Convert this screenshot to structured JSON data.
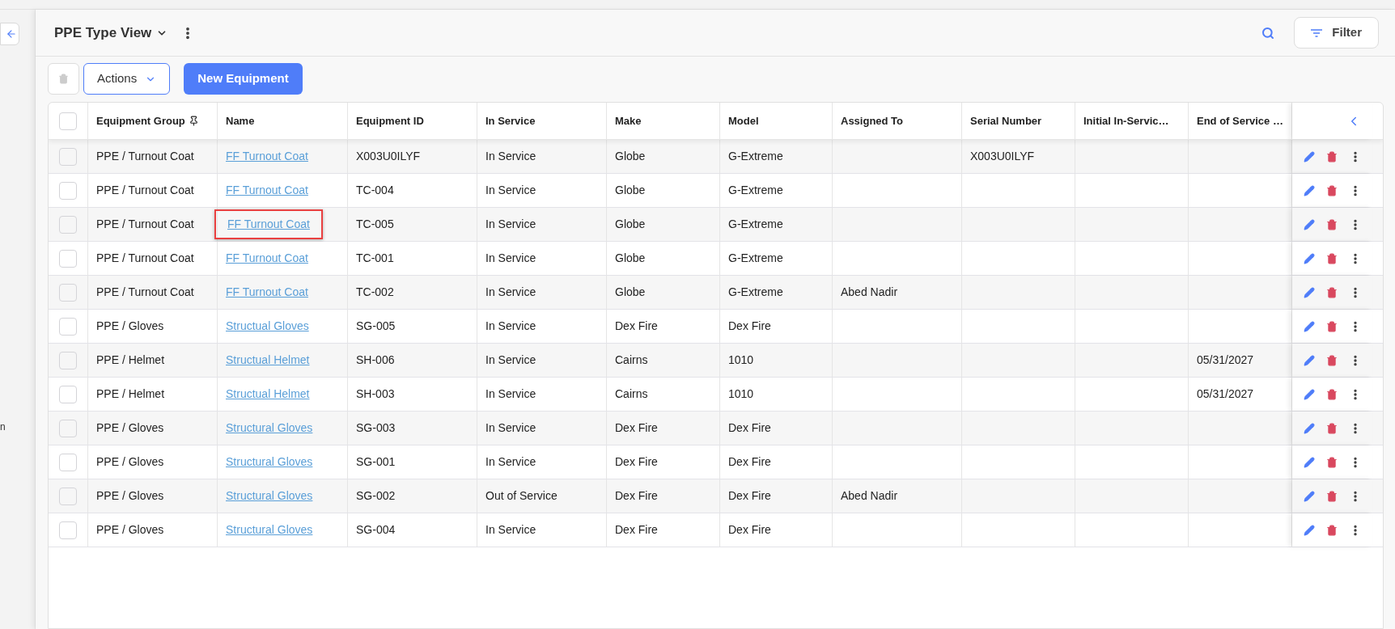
{
  "sidebar": {
    "partial_text": "n"
  },
  "header": {
    "title": "PPE Type View",
    "filter_label": "Filter"
  },
  "toolbar": {
    "actions_label": "Actions",
    "new_label": "New Equipment"
  },
  "table": {
    "header_checked": false,
    "columns": [
      {
        "label": "Equipment Group",
        "pinned": true
      },
      {
        "label": "Name",
        "pinned": false
      },
      {
        "label": "Equipment ID",
        "pinned": false
      },
      {
        "label": "In Service",
        "pinned": false
      },
      {
        "label": "Make",
        "pinned": false
      },
      {
        "label": "Model",
        "pinned": false
      },
      {
        "label": "Assigned To",
        "pinned": false
      },
      {
        "label": "Serial Number",
        "pinned": false
      },
      {
        "label": "Initial In-Servic…",
        "pinned": false
      },
      {
        "label": "End of Service …",
        "pinned": false
      }
    ],
    "rows": [
      {
        "checked": false,
        "highlighted": false,
        "cells": [
          "PPE / Turnout Coat",
          "FF Turnout Coat",
          "X003U0ILYF",
          "In Service",
          "Globe",
          "G-Extreme",
          "",
          "X003U0ILYF",
          "",
          ""
        ]
      },
      {
        "checked": false,
        "highlighted": false,
        "cells": [
          "PPE / Turnout Coat",
          "FF Turnout Coat",
          "TC-004",
          "In Service",
          "Globe",
          "G-Extreme",
          "",
          "",
          "",
          ""
        ]
      },
      {
        "checked": false,
        "highlighted": true,
        "cells": [
          "PPE / Turnout Coat",
          "FF Turnout Coat",
          "TC-005",
          "In Service",
          "Globe",
          "G-Extreme",
          "",
          "",
          "",
          ""
        ]
      },
      {
        "checked": false,
        "highlighted": false,
        "cells": [
          "PPE / Turnout Coat",
          "FF Turnout Coat",
          "TC-001",
          "In Service",
          "Globe",
          "G-Extreme",
          "",
          "",
          "",
          ""
        ]
      },
      {
        "checked": false,
        "highlighted": false,
        "cells": [
          "PPE / Turnout Coat",
          "FF Turnout Coat",
          "TC-002",
          "In Service",
          "Globe",
          "G-Extreme",
          "Abed Nadir",
          "",
          "",
          ""
        ]
      },
      {
        "checked": false,
        "highlighted": false,
        "cells": [
          "PPE / Gloves",
          "Structual Gloves",
          "SG-005",
          "In Service",
          "Dex Fire",
          "Dex Fire",
          "",
          "",
          "",
          ""
        ]
      },
      {
        "checked": false,
        "highlighted": false,
        "cells": [
          "PPE / Helmet",
          "Structual Helmet",
          "SH-006",
          "In Service",
          "Cairns",
          "1010",
          "",
          "",
          "",
          "05/31/2027"
        ]
      },
      {
        "checked": false,
        "highlighted": false,
        "cells": [
          "PPE / Helmet",
          "Structual Helmet",
          "SH-003",
          "In Service",
          "Cairns",
          "1010",
          "",
          "",
          "",
          "05/31/2027"
        ]
      },
      {
        "checked": false,
        "highlighted": false,
        "cells": [
          "PPE / Gloves",
          "Structural Gloves",
          "SG-003",
          "In Service",
          "Dex Fire",
          "Dex Fire",
          "",
          "",
          "",
          ""
        ]
      },
      {
        "checked": false,
        "highlighted": false,
        "cells": [
          "PPE / Gloves",
          "Structural Gloves",
          "SG-001",
          "In Service",
          "Dex Fire",
          "Dex Fire",
          "",
          "",
          "",
          ""
        ]
      },
      {
        "checked": false,
        "highlighted": false,
        "cells": [
          "PPE / Gloves",
          "Structural Gloves",
          "SG-002",
          "Out of Service",
          "Dex Fire",
          "Dex Fire",
          "Abed Nadir",
          "",
          "",
          ""
        ]
      },
      {
        "checked": false,
        "highlighted": false,
        "cells": [
          "PPE / Gloves",
          "Structural Gloves",
          "SG-004",
          "In Service",
          "Dex Fire",
          "Dex Fire",
          "",
          "",
          "",
          ""
        ]
      }
    ]
  }
}
